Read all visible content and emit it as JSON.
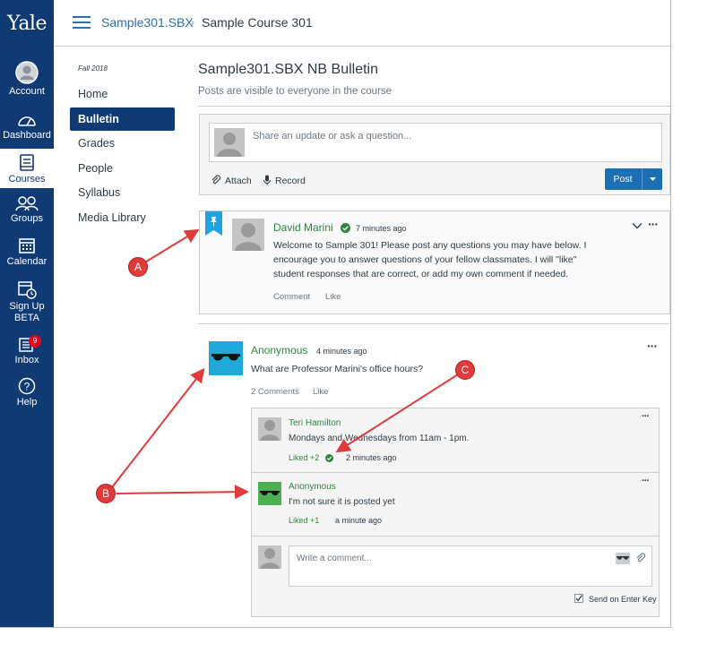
{
  "global_nav": {
    "logo": "Yale",
    "items": [
      {
        "label": "Account"
      },
      {
        "label": "Dashboard"
      },
      {
        "label": "Courses"
      },
      {
        "label": "Groups"
      },
      {
        "label": "Calendar"
      },
      {
        "label": "Sign Up",
        "label2": "BETA"
      },
      {
        "label": "Inbox",
        "badge": "9"
      },
      {
        "label": "Help"
      }
    ],
    "active_item": "Courses",
    "colors": {
      "background": "#0f3a74",
      "badge": "#e0061f"
    }
  },
  "header": {
    "breadcrumb": [
      "Sample301.SBX",
      "Sample Course 301"
    ],
    "separator": "›"
  },
  "course_nav": {
    "term": "Fall 2018",
    "items": [
      "Home",
      "Bulletin",
      "Grades",
      "People",
      "Syllabus",
      "Media Library"
    ],
    "active_item": "Bulletin"
  },
  "main": {
    "title": "Sample301.SBX NB Bulletin",
    "subtitle": "Posts are visible to everyone in the course",
    "composer": {
      "placeholder": "Share an update or ask a question...",
      "attach_label": "Attach",
      "record_label": "Record",
      "post_label": "Post"
    },
    "pinned_post": {
      "author": "David Marini",
      "time": "7 minutes ago",
      "body_lines": [
        "Welcome to Sample 301!  Please post any questions you may have below.  I",
        "encourage you to answer questions of your fellow classmates.  I will \"like\"",
        "student responses that are correct, or add my own comment if needed."
      ],
      "comment_label": "Comment",
      "like_label": "Like"
    },
    "question_post": {
      "author": "Anonymous",
      "time": "4 minutes ago",
      "body": "What are Professor Marini's office hours?",
      "comments_label": "2 Comments",
      "like_label": "Like",
      "replies": [
        {
          "author": "Teri Hamilton",
          "text": "Mondays and Wednesdays from 11am - 1pm.",
          "liked": "Liked +2",
          "time": "2 minutes ago"
        },
        {
          "author": "Anonymous",
          "text": "I'm not sure it is posted yet",
          "liked": "Liked +1",
          "time": "a minute ago"
        }
      ],
      "comment_placeholder": "Write a comment...",
      "send_on_enter": "Send on Enter Key"
    },
    "colors": {
      "accent_green": "#2e8540",
      "link_blue": "#2d6fa6",
      "button_blue": "#1c6fb5",
      "anon_blue_avatar": "#1fa8d8",
      "anon_green_avatar": "#4caf50"
    }
  },
  "annotations": {
    "callouts": [
      "A",
      "B",
      "C"
    ],
    "color": "#e03a3a"
  }
}
